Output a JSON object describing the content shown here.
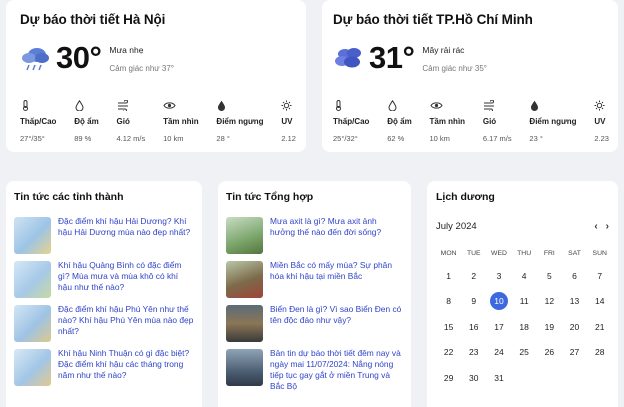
{
  "weather": [
    {
      "title": "Dự báo thời tiết Hà Nội",
      "icon": "rain-cloud-icon",
      "temp": "30°",
      "condition": "Mưa nhẹ",
      "feels_like": "Cảm giác như 37°",
      "metrics": [
        {
          "icon": "thermometer-icon",
          "label": "Thấp/Cao",
          "value": "27°/35°"
        },
        {
          "icon": "humidity-icon",
          "label": "Độ ẩm",
          "value": "89 %"
        },
        {
          "icon": "wind-icon",
          "label": "Gió",
          "value": "4.12 m/s"
        },
        {
          "icon": "eye-icon",
          "label": "Tầm nhìn",
          "value": "10 km"
        },
        {
          "icon": "dew-point-icon",
          "label": "Điểm ngưng",
          "value": "28 °"
        },
        {
          "icon": "sun-icon",
          "label": "UV",
          "value": "2.12"
        }
      ]
    },
    {
      "title": "Dự báo thời tiết TP.Hồ Chí Minh",
      "icon": "clouds-icon",
      "temp": "31°",
      "condition": "Mây rải rác",
      "feels_like": "Cảm giác như 35°",
      "metrics": [
        {
          "icon": "thermometer-icon",
          "label": "Thấp/Cao",
          "value": "25°/32°"
        },
        {
          "icon": "humidity-icon",
          "label": "Độ ẩm",
          "value": "62 %"
        },
        {
          "icon": "eye-icon",
          "label": "Tầm nhìn",
          "value": "10 km"
        },
        {
          "icon": "wind-icon",
          "label": "Gió",
          "value": "6.17 m/s"
        },
        {
          "icon": "dew-point-icon",
          "label": "Điểm ngưng",
          "value": "23 °"
        },
        {
          "icon": "sun-icon",
          "label": "UV",
          "value": "2.23"
        }
      ]
    }
  ],
  "news_provinces": {
    "title": "Tin tức các tỉnh thành",
    "items": [
      "Đặc điểm khí hậu Hải Dương? Khí hậu Hải Dương mùa nào đẹp nhất?",
      "Khí hậu Quảng Bình có đặc điểm gì? Mùa mưa và mùa khô có khí hậu như thế nào?",
      "Đặc điểm khí hậu Phú Yên như thế nào? Khí hậu Phú Yên mùa nào đẹp nhất?",
      "Khí hậu Ninh Thuận có gì đặc biệt? Đặc điểm khí hậu các tháng trong năm như thế nào?"
    ]
  },
  "news_general": {
    "title": "Tin tức Tổng hợp",
    "items": [
      "Mưa axit là gì? Mưa axit ảnh hưởng thế nào đến đời sống?",
      "Miền Bắc có mấy mùa? Sự phân hóa khí hậu tại miền Bắc",
      "Biển Đen là gì? Vì sao Biển Đen có tên độc đáo như vậy?",
      "Bản tin dự báo thời tiết đêm nay và ngày mai 11/07/2024: Nắng nóng tiếp tục gay gắt ở miền Trung và Bắc Bộ"
    ]
  },
  "calendar": {
    "title": "Lịch dương",
    "month": "July 2024",
    "prev": "‹",
    "next": "›",
    "weekdays": [
      "MON",
      "TUE",
      "WED",
      "THU",
      "FRI",
      "SAT",
      "SUN"
    ],
    "weeks": [
      [
        "1",
        "2",
        "3",
        "4",
        "5",
        "6",
        "7"
      ],
      [
        "8",
        "9",
        "10",
        "11",
        "12",
        "13",
        "14"
      ],
      [
        "15",
        "16",
        "17",
        "18",
        "19",
        "20",
        "21"
      ],
      [
        "22",
        "23",
        "24",
        "25",
        "26",
        "27",
        "28"
      ],
      [
        "29",
        "30",
        "31",
        "",
        "",
        "",
        ""
      ]
    ],
    "today": "10",
    "accent": "#3d68e0"
  },
  "colors": {
    "link": "#2f44c9",
    "background": "#f0f1f4"
  }
}
